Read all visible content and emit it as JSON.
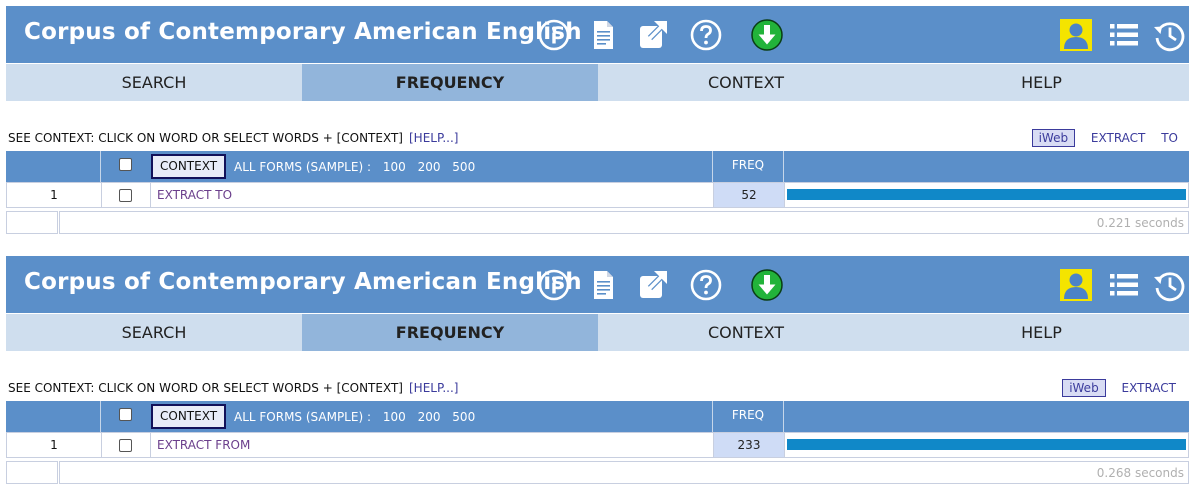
{
  "colors": {
    "header_bg": "#5b8fc9",
    "nav_bg": "#cfdeee",
    "nav_active_bg": "#92b5db",
    "bar": "#1088c8",
    "download_icon": "#22b33a",
    "user_icon_bg": "#f4e400"
  },
  "panels": [
    {
      "app_title": "Corpus of Contemporary American English",
      "icons": [
        "info-icon",
        "document-icon",
        "external-link-icon",
        "help-icon",
        "download-icon",
        "user-icon",
        "list-icon",
        "history-icon"
      ],
      "nav": [
        "SEARCH",
        "FREQUENCY",
        "CONTEXT",
        "HELP"
      ],
      "active_tab": "FREQUENCY",
      "hint": "SEE CONTEXT: CLICK ON WORD OR SELECT WORDS + [CONTEXT]",
      "hint_help": "[HELP...]",
      "corpus_links": [
        "iWeb",
        "EXTRACT",
        "TO"
      ],
      "table_header": {
        "context_button": "CONTEXT",
        "all_forms": "ALL FORMS  (SAMPLE) :",
        "sample_sizes": [
          "100",
          "200",
          "500"
        ],
        "freq": "FREQ"
      },
      "rows": [
        {
          "num": "1",
          "word": "EXTRACT TO",
          "freq": "52",
          "bar_fraction": 1.0
        }
      ],
      "time": "0.221 seconds"
    },
    {
      "app_title": "Corpus of Contemporary American English",
      "icons": [
        "info-icon",
        "document-icon",
        "external-link-icon",
        "help-icon",
        "download-icon",
        "user-icon",
        "list-icon",
        "history-icon"
      ],
      "nav": [
        "SEARCH",
        "FREQUENCY",
        "CONTEXT",
        "HELP"
      ],
      "active_tab": "FREQUENCY",
      "hint": "SEE CONTEXT: CLICK ON WORD OR SELECT WORDS + [CONTEXT]",
      "hint_help": "[HELP...]",
      "corpus_links": [
        "iWeb",
        "EXTRACT"
      ],
      "table_header": {
        "context_button": "CONTEXT",
        "all_forms": "ALL FORMS  (SAMPLE) :",
        "sample_sizes": [
          "100",
          "200",
          "500"
        ],
        "freq": "FREQ"
      },
      "rows": [
        {
          "num": "1",
          "word": "EXTRACT FROM",
          "freq": "233",
          "bar_fraction": 1.0
        }
      ],
      "time": "0.268 seconds"
    }
  ]
}
